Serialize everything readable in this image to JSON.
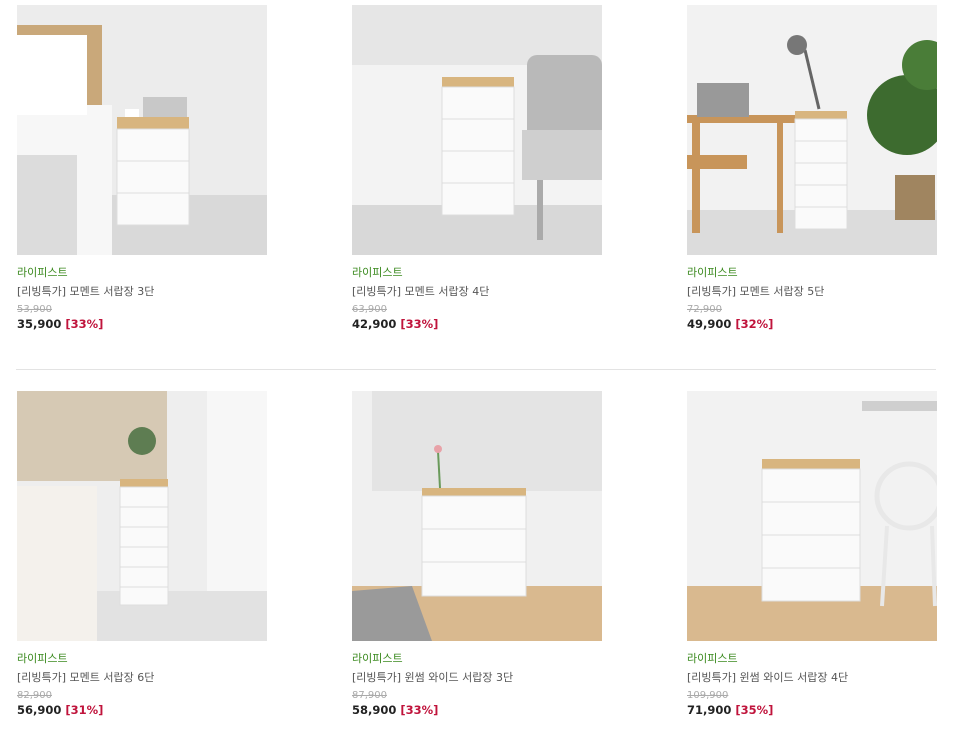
{
  "products": [
    {
      "brand": "라이피스트",
      "name": "[리빙특가] 모멘트 서랍장 3단",
      "original_price": "53,900",
      "price": "35,900",
      "discount": "[33%]",
      "image_icon": "product-photo-icon"
    },
    {
      "brand": "라이피스트",
      "name": "[리빙특가] 모멘트 서랍장 4단",
      "original_price": "63,900",
      "price": "42,900",
      "discount": "[33%]",
      "image_icon": "product-photo-icon"
    },
    {
      "brand": "라이피스트",
      "name": "[리빙특가] 모멘트 서랍장 5단",
      "original_price": "72,900",
      "price": "49,900",
      "discount": "[32%]",
      "image_icon": "product-photo-icon"
    },
    {
      "brand": "라이피스트",
      "name": "[리빙특가] 모멘트 서랍장 6단",
      "original_price": "82,900",
      "price": "56,900",
      "discount": "[31%]",
      "image_icon": "product-photo-icon"
    },
    {
      "brand": "라이피스트",
      "name": "[리빙특가] 윈썸 와이드 서랍장 3단",
      "original_price": "87,900",
      "price": "58,900",
      "discount": "[33%]",
      "image_icon": "product-photo-icon"
    },
    {
      "brand": "라이피스트",
      "name": "[리빙특가] 윈썸 와이드 서랍장 4단",
      "original_price": "109,900",
      "price": "71,900",
      "discount": "[35%]",
      "image_icon": "product-photo-icon"
    }
  ],
  "colors": {
    "brand_text": "#3b8a1f",
    "discount_text": "#c0143c",
    "strikethrough_text": "#aaaaaa"
  }
}
